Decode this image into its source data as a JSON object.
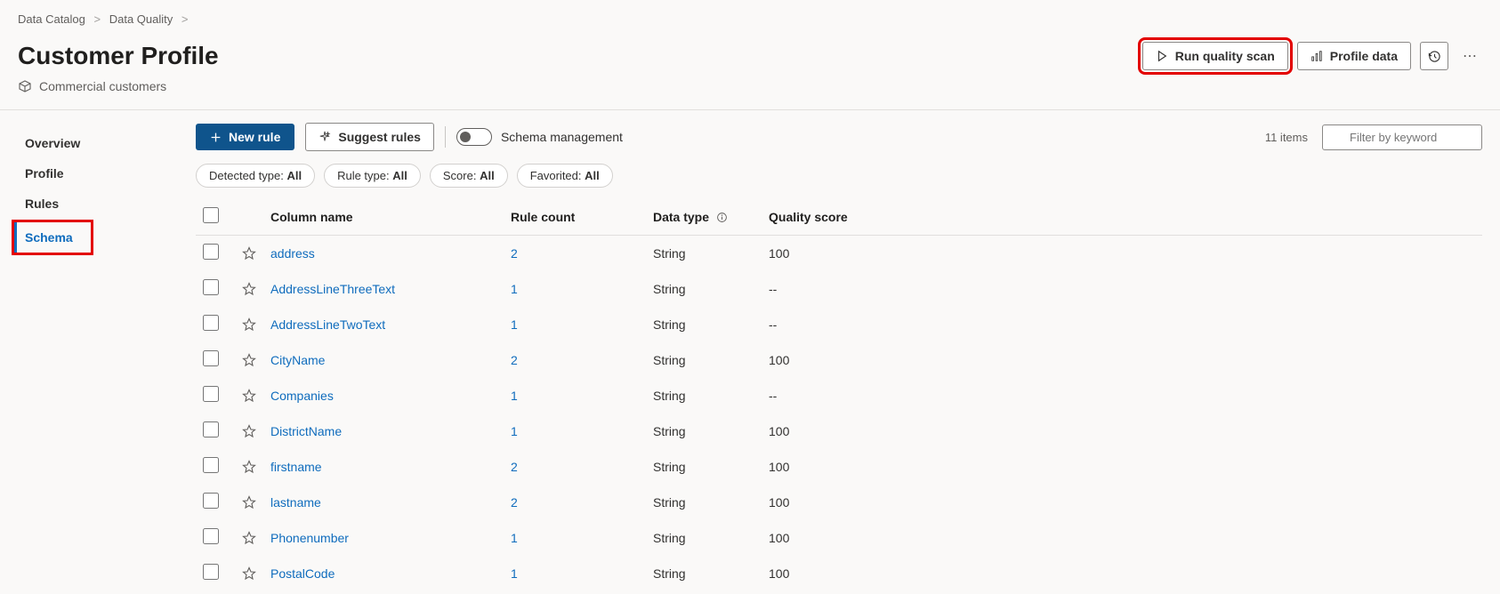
{
  "breadcrumb": {
    "items": [
      "Data Catalog",
      "Data Quality"
    ]
  },
  "page": {
    "title": "Customer Profile",
    "subtitle": "Commercial customers"
  },
  "header_actions": {
    "run_scan": "Run quality scan",
    "profile_data": "Profile data"
  },
  "sidebar": {
    "items": [
      {
        "label": "Overview",
        "selected": false
      },
      {
        "label": "Profile",
        "selected": false
      },
      {
        "label": "Rules",
        "selected": false
      },
      {
        "label": "Schema",
        "selected": true
      }
    ]
  },
  "toolbar": {
    "new_rule": "New rule",
    "suggest_rules": "Suggest rules",
    "schema_mgmt_label": "Schema management",
    "item_count": "11 items",
    "filter_placeholder": "Filter by keyword"
  },
  "pills": [
    {
      "label": "Detected type:",
      "value": "All"
    },
    {
      "label": "Rule type:",
      "value": "All"
    },
    {
      "label": "Score:",
      "value": "All"
    },
    {
      "label": "Favorited:",
      "value": "All"
    }
  ],
  "table": {
    "headers": {
      "column_name": "Column name",
      "rule_count": "Rule count",
      "data_type": "Data type",
      "quality_score": "Quality score"
    },
    "rows": [
      {
        "name": "address",
        "rule_count": "2",
        "data_type": "String",
        "quality_score": "100"
      },
      {
        "name": "AddressLineThreeText",
        "rule_count": "1",
        "data_type": "String",
        "quality_score": "--"
      },
      {
        "name": "AddressLineTwoText",
        "rule_count": "1",
        "data_type": "String",
        "quality_score": "--"
      },
      {
        "name": "CityName",
        "rule_count": "2",
        "data_type": "String",
        "quality_score": "100"
      },
      {
        "name": "Companies",
        "rule_count": "1",
        "data_type": "String",
        "quality_score": "--"
      },
      {
        "name": "DistrictName",
        "rule_count": "1",
        "data_type": "String",
        "quality_score": "100"
      },
      {
        "name": "firstname",
        "rule_count": "2",
        "data_type": "String",
        "quality_score": "100"
      },
      {
        "name": "lastname",
        "rule_count": "2",
        "data_type": "String",
        "quality_score": "100"
      },
      {
        "name": "Phonenumber",
        "rule_count": "1",
        "data_type": "String",
        "quality_score": "100"
      },
      {
        "name": "PostalCode",
        "rule_count": "1",
        "data_type": "String",
        "quality_score": "100"
      }
    ]
  }
}
